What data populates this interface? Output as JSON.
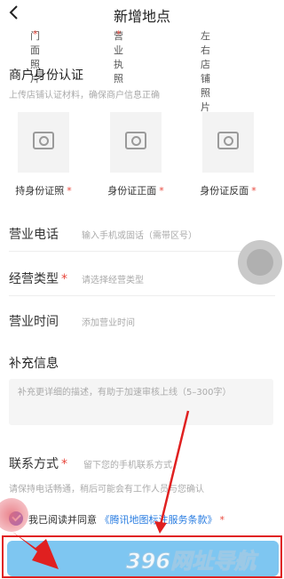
{
  "header": {
    "title": "新增地点"
  },
  "top_labels": [
    "门面照片",
    "营业执照",
    "左右店铺照片"
  ],
  "identity": {
    "title": "商户身份认证",
    "hint": "上传店铺认证材料，确保商户信息正确",
    "uploads": [
      "持身份证照",
      "身份证正面",
      "身份证反面"
    ]
  },
  "fields": {
    "phone": {
      "label": "营业电话",
      "placeholder": "输入手机或固话（需带区号）"
    },
    "type": {
      "label": "经营类型",
      "placeholder": "请选择经营类型"
    },
    "hours": {
      "label": "营业时间",
      "placeholder": "添加营业时间"
    }
  },
  "supplement": {
    "title": "补充信息",
    "placeholder": "补充更详细的描述，有助于加速审核上线（5–300字）"
  },
  "contact": {
    "label": "联系方式",
    "placeholder": "留下您的手机联系方式",
    "hint": "请保持电话畅通，稍后可能会有工作人员与您确认"
  },
  "agreement": {
    "prefix": "我已阅读并同意",
    "link": "《腾讯地图标注服务条款》"
  },
  "watermark_text": "396网址导航",
  "colors": {
    "accent": "#7ec6f1",
    "link": "#2a7de1",
    "required": "#e8463b",
    "annotation": "#e02020"
  }
}
